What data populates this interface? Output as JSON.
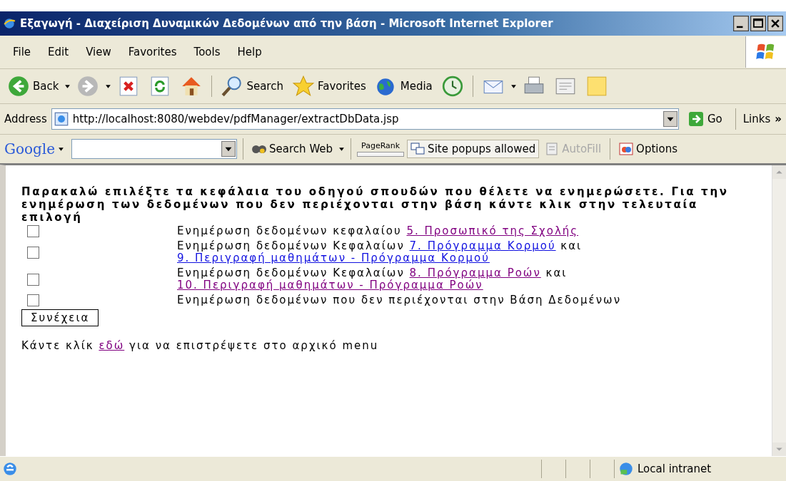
{
  "window": {
    "title": "Εξαγωγή - Διαχείριση Δυναμικών Δεδομένων από την βάση - Microsoft Internet Explorer"
  },
  "menu": [
    "File",
    "Edit",
    "View",
    "Favorites",
    "Tools",
    "Help"
  ],
  "toolbar": [
    {
      "kind": "back",
      "label": "Back"
    },
    {
      "kind": "forward"
    },
    {
      "kind": "stop"
    },
    {
      "kind": "refresh"
    },
    {
      "kind": "home"
    },
    {
      "kind": "search",
      "label": "Search"
    },
    {
      "kind": "favorites",
      "label": "Favorites"
    },
    {
      "kind": "media",
      "label": "Media"
    },
    {
      "kind": "history"
    },
    {
      "kind": "mail"
    },
    {
      "kind": "print"
    },
    {
      "kind": "edit"
    },
    {
      "kind": "note"
    }
  ],
  "address": {
    "label": "Address",
    "value": "http://localhost:8080/webdev/pdfManager/extractDbData.jsp",
    "go": "Go",
    "links": "Links",
    "more": "»"
  },
  "google": {
    "logo": "Google",
    "search": "Search Web",
    "pagerank": "PageRank",
    "popups": "Site popups allowed",
    "autofill": "AutoFill",
    "options": "Options"
  },
  "content": {
    "heading": "Παρακαλώ επιλέξτε τα κεφάλαια του οδηγού σπουδών που θέλετε να ενημερώσετε. Για την ενημέρωση των δεδομένων που δεν περιέχονται στην βάση κάντε κλικ στην τελευταία επιλογή",
    "options": [
      {
        "checked": false,
        "parts": [
          {
            "kind": "text",
            "text": "Ενημέρωση δεδομένων κεφαλαίου "
          },
          {
            "kind": "link",
            "text": "5. Προσωπικό της Σχολής",
            "visited": true
          }
        ]
      },
      {
        "checked": false,
        "parts": [
          {
            "kind": "text",
            "text": "Ενημέρωση δεδομένων Κεφαλαίων "
          },
          {
            "kind": "link",
            "text": "7. Πρόγραμμα Κορμού",
            "visited": false
          },
          {
            "kind": "text",
            "text": " και "
          },
          {
            "kind": "link",
            "text": "9. Περιγραφή μαθημάτων - Πρόγραμμα Κορμού",
            "visited": false
          }
        ]
      },
      {
        "checked": false,
        "parts": [
          {
            "kind": "text",
            "text": "Ενημέρωση δεδομένων Κεφαλαίων "
          },
          {
            "kind": "link",
            "text": "8. Πρόγραμμα Ροών",
            "visited": true
          },
          {
            "kind": "text",
            "text": " και "
          },
          {
            "kind": "link",
            "text": "10. Περιγραφή μαθημάτων - Πρόγραμμα Ροών",
            "visited": true
          }
        ]
      },
      {
        "checked": false,
        "parts": [
          {
            "kind": "text",
            "text": "Ενημέρωση δεδομένων που δεν περιέχονται στην Βάση Δεδομένων"
          }
        ]
      }
    ],
    "button": "Συνέχεια",
    "back_line": [
      {
        "kind": "text",
        "text": "Κάντε κλίκ "
      },
      {
        "kind": "link",
        "text": "εδώ",
        "visited": true
      },
      {
        "kind": "text",
        "text": " για να επιστρέψετε στο αρχικό menu"
      }
    ]
  },
  "status_bar": {
    "zone": "Local intranet"
  }
}
